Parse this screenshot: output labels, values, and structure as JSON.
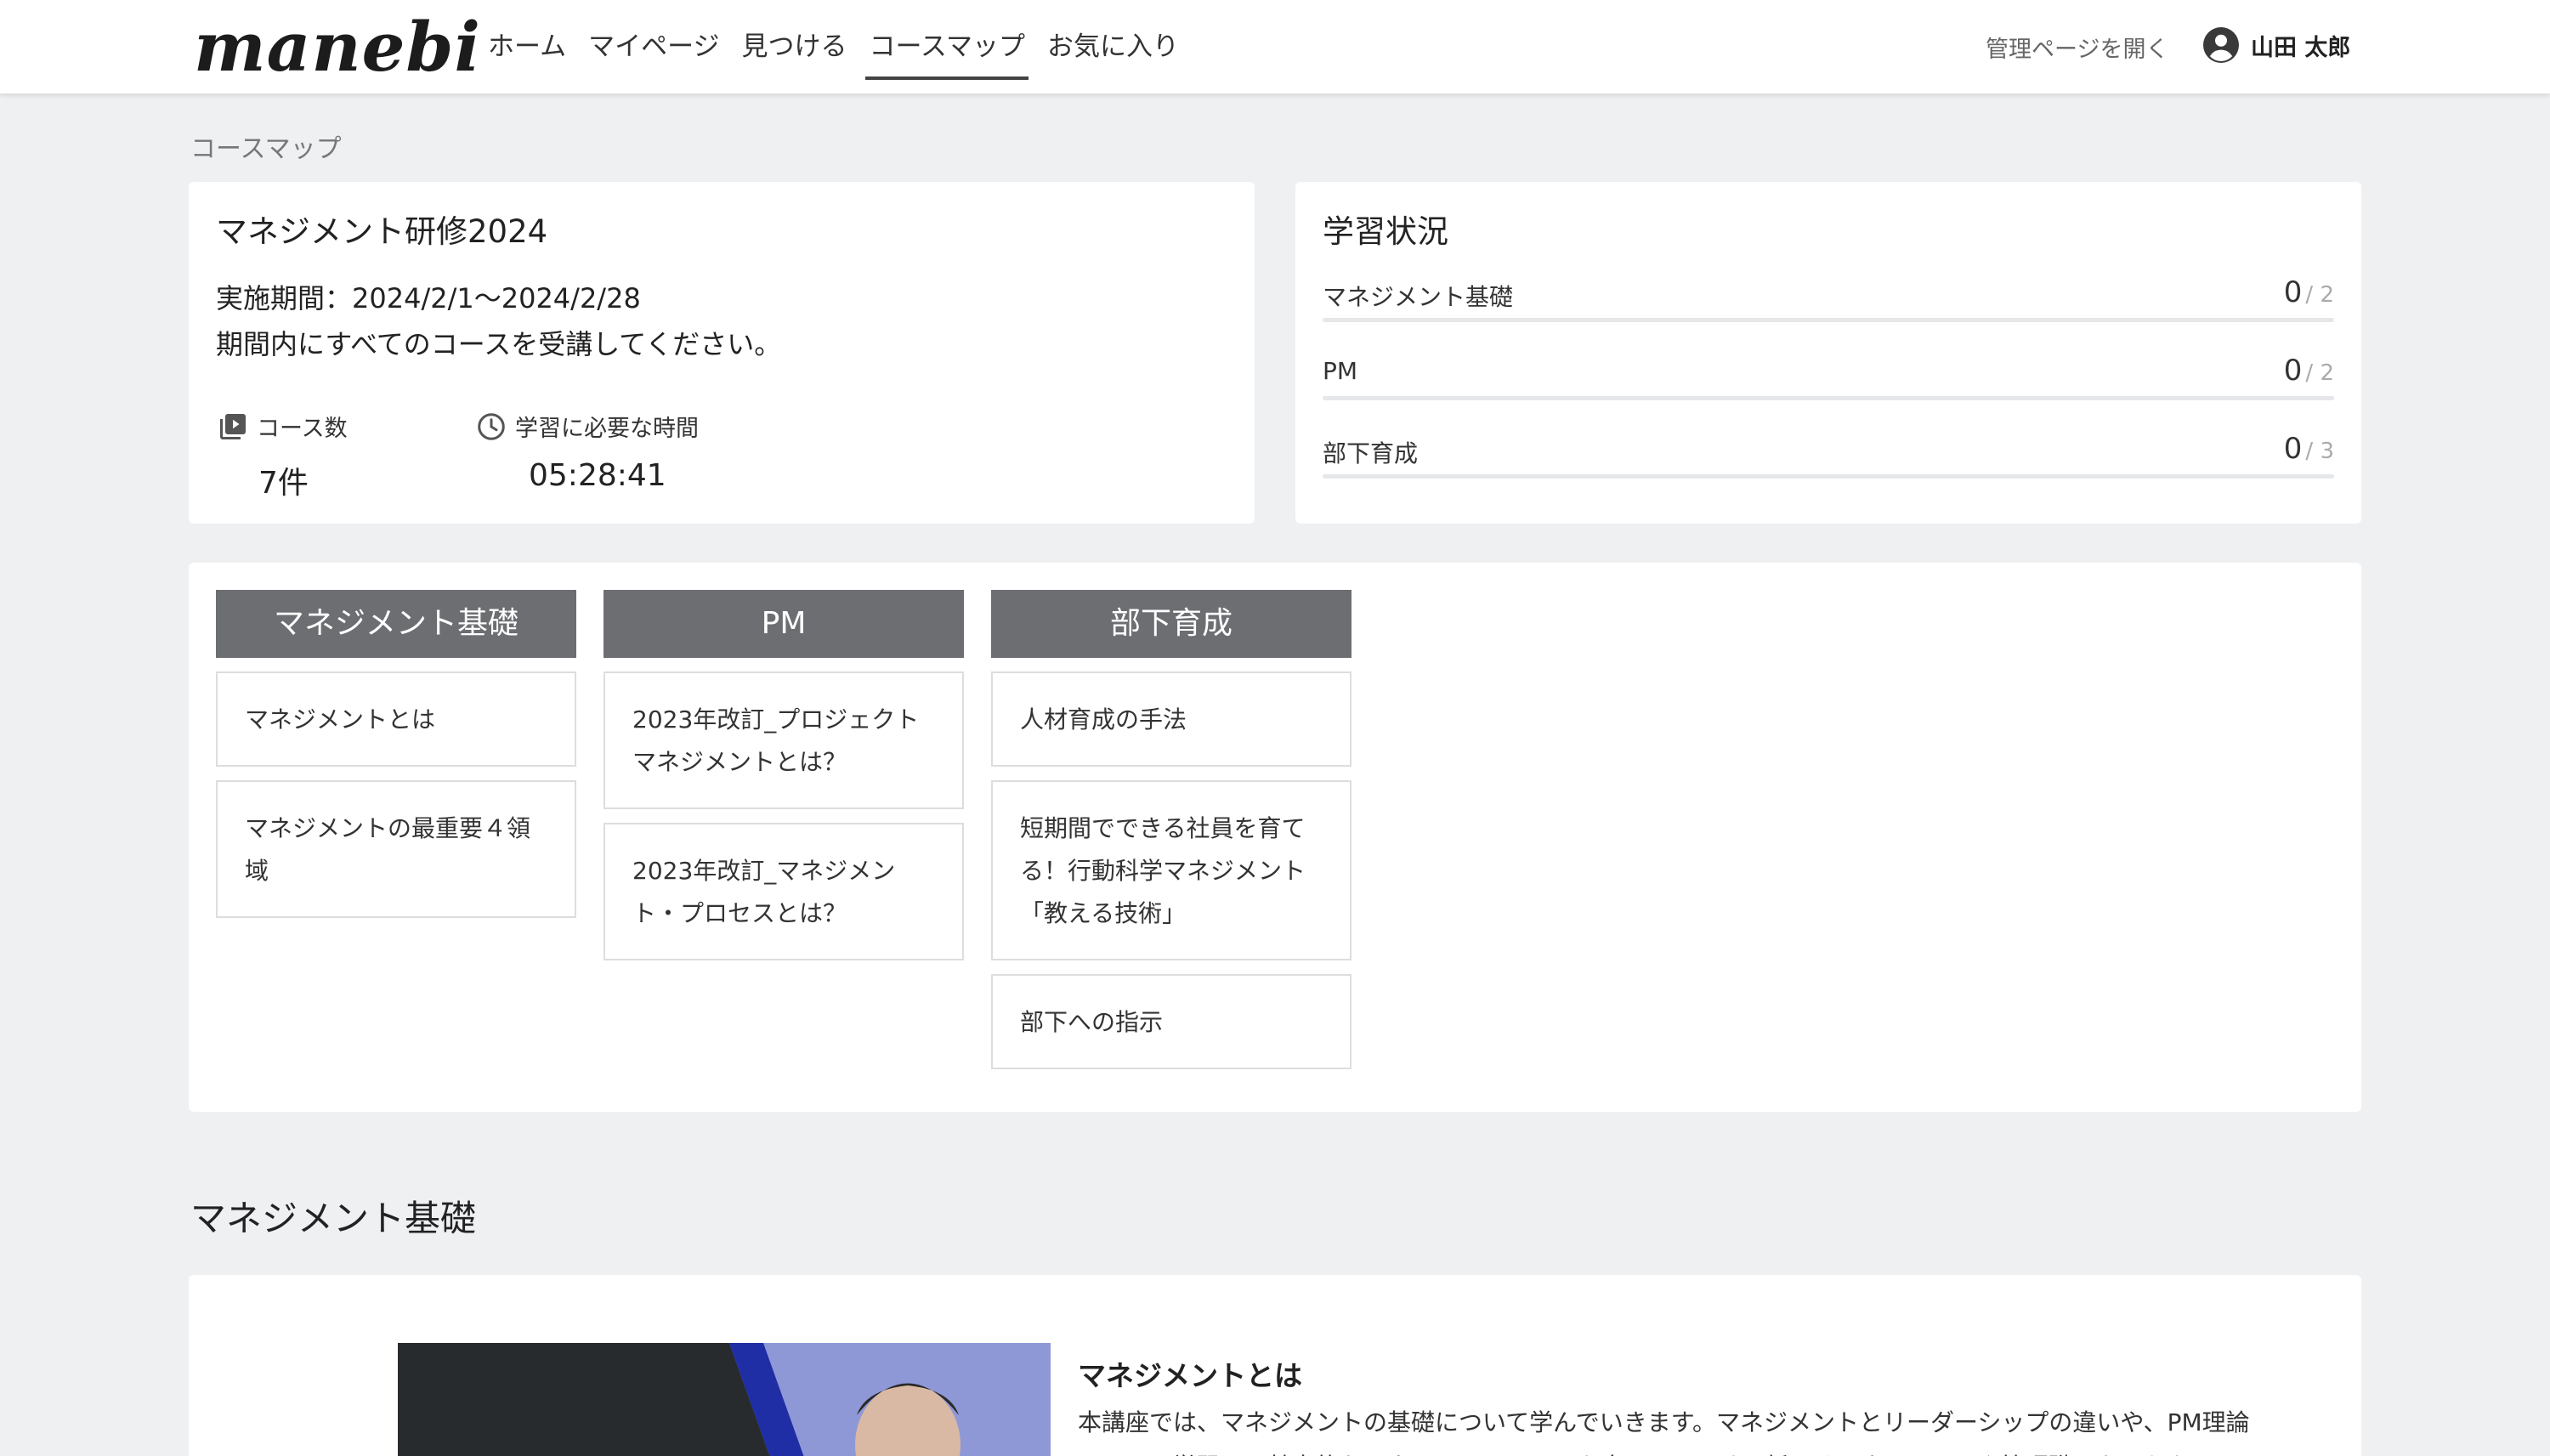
{
  "header": {
    "logo": "manebi",
    "nav": [
      {
        "label": "ホーム",
        "active": false
      },
      {
        "label": "マイページ",
        "active": false
      },
      {
        "label": "見つける",
        "active": false
      },
      {
        "label": "コースマップ",
        "active": true
      },
      {
        "label": "お気に入り",
        "active": false
      }
    ],
    "admin_link": "管理ページを開く",
    "user_name": "山田 太郎",
    "user_icon": "account-circle-icon"
  },
  "breadcrumb": "コースマップ",
  "program": {
    "title": "マネジメント研修2024",
    "period": "実施期間：2024/2/1〜2024/2/28",
    "description": "期間内にすべてのコースを受講してください。",
    "course_count_label": "コース数",
    "course_count_value": "7件",
    "course_count_icon": "play-library-icon",
    "study_time_label": "学習に必要な時間",
    "study_time_value": "05:28:41",
    "study_time_icon": "clock-icon"
  },
  "progress": {
    "title": "学習状況",
    "rows": [
      {
        "name": "マネジメント基礎",
        "done": "0",
        "total": "/ 2",
        "ratio": 0
      },
      {
        "name": "PM",
        "done": "0",
        "total": "/ 2",
        "ratio": 0
      },
      {
        "name": "部下育成",
        "done": "0",
        "total": "/ 3",
        "ratio": 0
      }
    ]
  },
  "course_map": [
    {
      "category": "マネジメント基礎",
      "courses": [
        "マネジメントとは",
        "マネジメントの最重要４領域"
      ]
    },
    {
      "category": "PM",
      "courses": [
        "2023年改訂_プロジェクトマネジメントとは？",
        "2023年改訂_マネジメント・プロセスとは？"
      ]
    },
    {
      "category": "部下育成",
      "courses": [
        "人材育成の手法",
        "短期間でできる社員を育てる！行動科学マネジメント「教える技術」",
        "部下への指示"
      ]
    }
  ],
  "section": {
    "title": "マネジメント基礎",
    "course": {
      "title": "マネジメントとは",
      "description": "本講座では、マネジメントの基礎について学んでいきます。マネジメントとリーダーシップの違いや、PM理論について学習し、基本的なマネジメントスキルを身につけます。新しくマネージャーや管理職になられた"
    }
  },
  "colors": {
    "page_bg": "#eff0f2",
    "category_header": "#6c6e72",
    "thumb_blue": "#1f2ea5"
  }
}
